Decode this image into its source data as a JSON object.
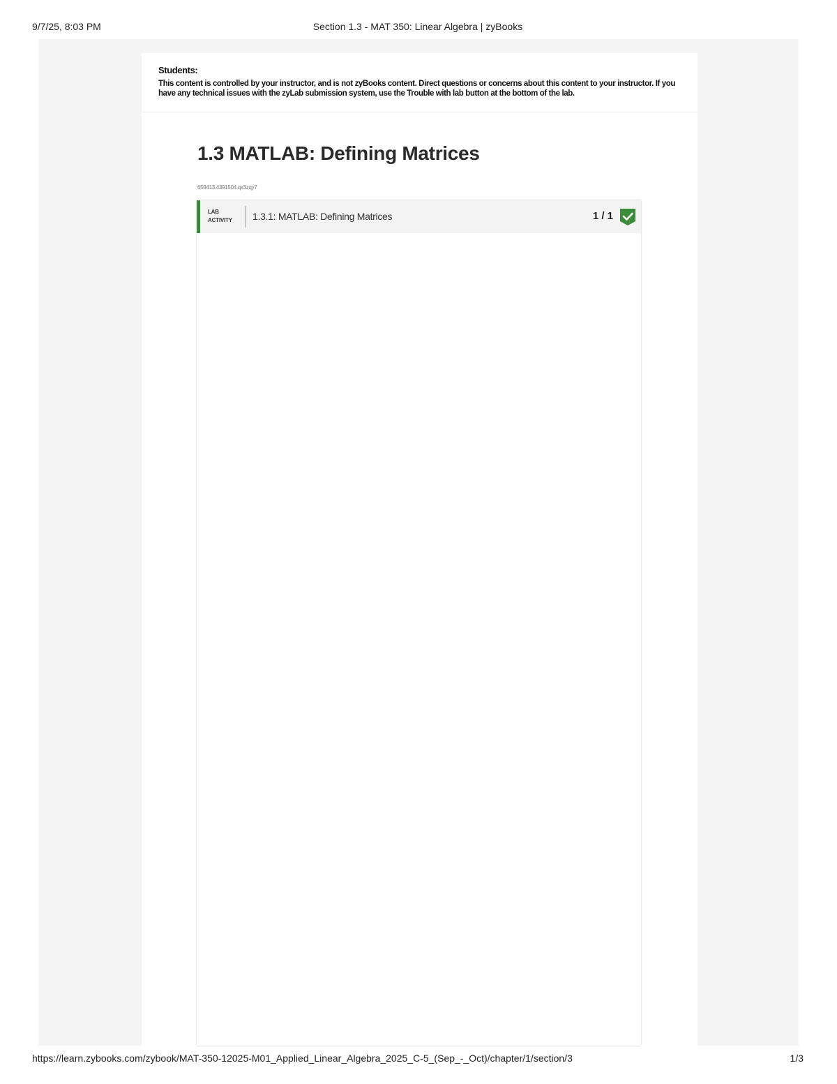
{
  "print_header": {
    "datetime": "9/7/25, 8:03 PM",
    "title": "Section 1.3 - MAT 350: Linear Algebra | zyBooks"
  },
  "notice": {
    "title": "Students:",
    "body": "This content is controlled by your instructor, and is not zyBooks content. Direct questions or concerns about this content to your instructor. If you have any technical issues with the zyLab submission system, use the Trouble with lab button at the bottom of the lab."
  },
  "section": {
    "title": "1.3 MATLAB: Defining Matrices",
    "id_text": "659413.4391504.qx3zqy7"
  },
  "lab_activity": {
    "label_line1": "LAB",
    "label_line2": "ACTIVITY",
    "name": "1.3.1: MATLAB: Defining Matrices",
    "score": "1 / 1",
    "status_icon": "check-icon",
    "status_color": "#3b8c3b"
  },
  "print_footer": {
    "url": "https://learn.zybooks.com/zybook/MAT-350-12025-M01_Applied_Linear_Algebra_2025_C-5_(Sep_-_Oct)/chapter/1/section/3",
    "page": "1/3"
  }
}
